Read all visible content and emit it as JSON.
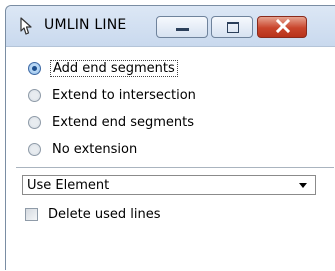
{
  "window": {
    "title": "UMLIN LINE",
    "icon": "mouse-pointer-icon",
    "accent_close": "#c9452c"
  },
  "options": [
    {
      "label": "Add end segments",
      "checked": true,
      "focused": true
    },
    {
      "label": "Extend to intersection",
      "checked": false,
      "focused": false
    },
    {
      "label": "Extend end segments",
      "checked": false,
      "focused": false
    },
    {
      "label": "No extension",
      "checked": false,
      "focused": false
    }
  ],
  "element_select": {
    "value": "Use Element"
  },
  "delete_lines": {
    "label": "Delete used lines",
    "checked": false
  }
}
